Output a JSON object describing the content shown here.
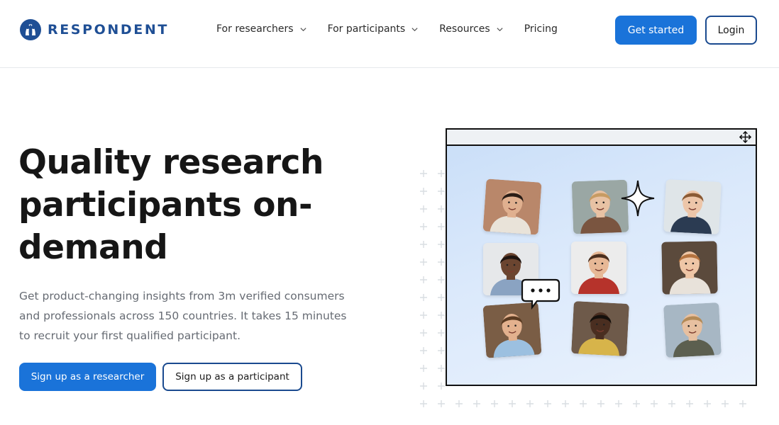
{
  "brand": {
    "name": "RESPONDENT",
    "logo_icon": "respondent-logo-icon",
    "color": "#1f4f95"
  },
  "nav": {
    "items": [
      {
        "label": "For researchers",
        "dropdown": true
      },
      {
        "label": "For participants",
        "dropdown": true
      },
      {
        "label": "Resources",
        "dropdown": true
      },
      {
        "label": "Pricing",
        "dropdown": false
      }
    ]
  },
  "header_actions": {
    "get_started": "Get started",
    "login": "Login"
  },
  "hero": {
    "title": "Quality research participants on-demand",
    "subtitle": "Get product-changing insights from 3m verified consumers and professionals across 150 countries. It takes 15 minutes to recruit your first qualified participant.",
    "cta_researcher": "Sign up as a researcher",
    "cta_participant": "Sign up as a participant"
  },
  "illustration": {
    "window_icon": "move-arrows-icon",
    "accent_icon": "sparkle-icon",
    "chat_icon": "chat-bubble-icon",
    "participant_tiles": [
      {
        "icon": "participant-avatar",
        "bg": "#b9876a",
        "skin": "#e0b08f",
        "hair": "#2a1d16",
        "shirt": "#e9e3d9"
      },
      {
        "icon": "participant-avatar",
        "bg": "#9aa7a4",
        "skin": "#e8c2a4",
        "hair": "#c79b63",
        "shirt": "#7a5540"
      },
      {
        "icon": "participant-avatar",
        "bg": "#dfe5e8",
        "skin": "#edc6a9",
        "hair": "#8a5a34",
        "shirt": "#2b3b52"
      },
      {
        "icon": "participant-avatar",
        "bg": "#e6e8ea",
        "skin": "#6b4530",
        "hair": "#1e1410",
        "shirt": "#8aa3c2"
      },
      {
        "icon": "participant-avatar",
        "bg": "#ececec",
        "skin": "#e7b896",
        "hair": "#4a2e1e",
        "shirt": "#b6332b"
      },
      {
        "icon": "participant-avatar",
        "bg": "#5b4a3c",
        "skin": "#efc6a6",
        "hair": "#b5733f",
        "shirt": "#e8e2da"
      },
      {
        "icon": "participant-avatar",
        "bg": "#7a5d45",
        "skin": "#e3b18e",
        "hair": "#5a3b22",
        "shirt": "#9cc0e0"
      },
      {
        "icon": "participant-avatar",
        "bg": "#6e5a4a",
        "skin": "#4a2e20",
        "hair": "#15100c",
        "shirt": "#d7b44a"
      },
      {
        "icon": "participant-avatar",
        "bg": "#a7b7c4",
        "skin": "#e7c0a0",
        "hair": "#b48a56",
        "shirt": "#5c5f4f"
      }
    ]
  },
  "colors": {
    "primary": "#1a73d9",
    "outline": "#1a4a8f",
    "text_dark": "#161616",
    "text_muted": "#666b73"
  }
}
